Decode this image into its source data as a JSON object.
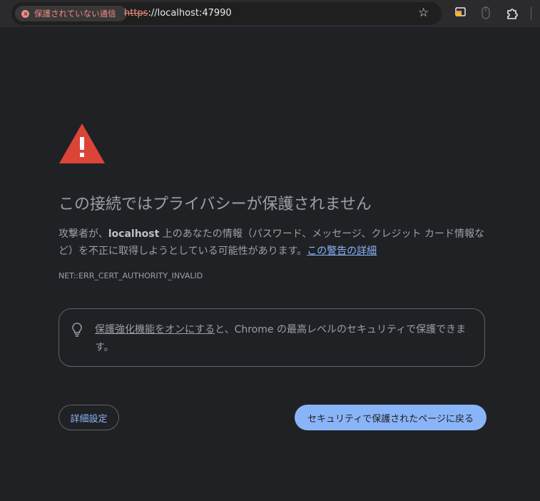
{
  "toolbar": {
    "security_chip_label": "保護されていない通信",
    "url_scheme": "https",
    "url_rest": "://localhost:47990",
    "bookmark_icon": "star-icon",
    "extension_icons": [
      "cast-icon",
      "mouse-icon",
      "puzzle-icon"
    ]
  },
  "interstitial": {
    "heading": "この接続ではプライバシーが保護されません",
    "desc_part1": "攻撃者が、",
    "desc_host": "localhost",
    "desc_part2": " 上のあなたの情報（パスワード、メッセージ、クレジット カード情報など）を不正に取得しようとしている可能性があります。",
    "details_link": "この警告の詳細",
    "error_code": "NET::ERR_CERT_AUTHORITY_INVALID",
    "callout_link": "保護強化機能をオンにする",
    "callout_text": "と、Chrome の最高レベルのセキュリティで保護できます。",
    "advanced_button": "詳細設定",
    "back_button": "セキュリティで保護されたページに戻る"
  },
  "colors": {
    "background": "#202124",
    "warning_red": "#db4437",
    "accent_blue": "#8ab4f8",
    "insecure_red": "#f28b82"
  }
}
